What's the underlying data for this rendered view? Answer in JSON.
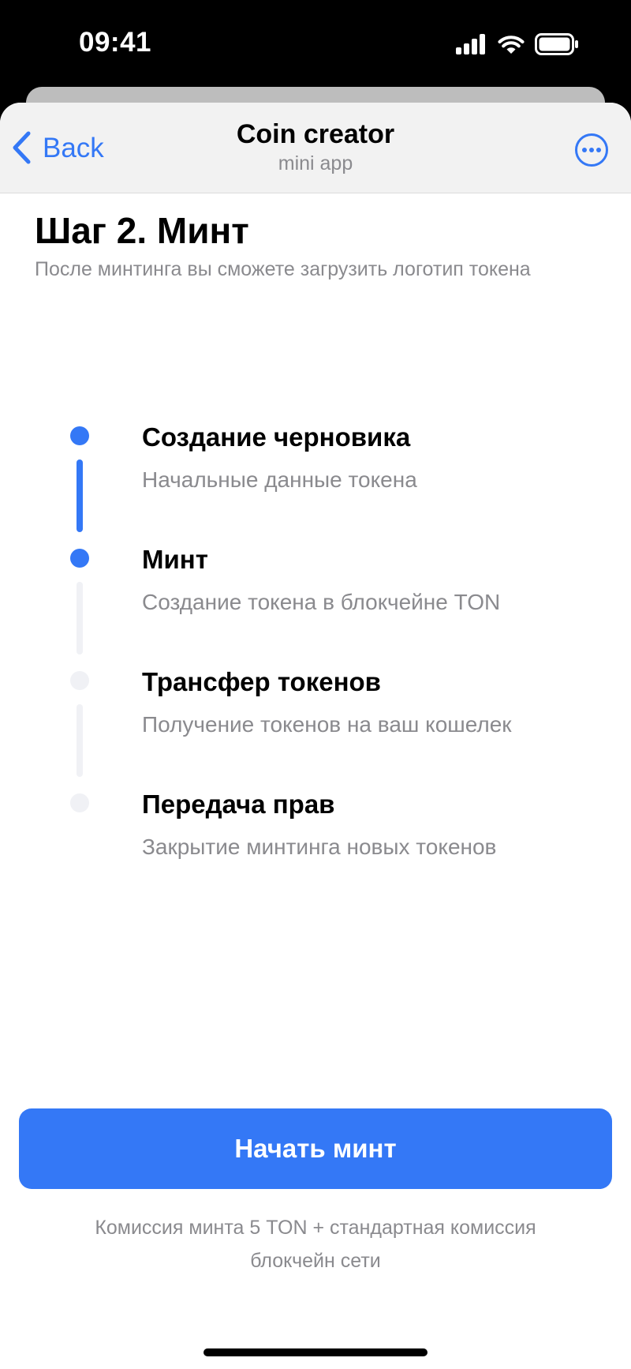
{
  "status_bar": {
    "time": "09:41",
    "icons": [
      "cellular-signal-icon",
      "wifi-icon",
      "battery-icon"
    ]
  },
  "header": {
    "back_label": "Back",
    "title": "Coin creator",
    "subtitle": "mini app",
    "more_icon": "more-ellipsis-icon"
  },
  "page": {
    "title": "Шаг 2. Минт",
    "subtitle": "После минтинга вы сможете загрузить логотип токена"
  },
  "steps": [
    {
      "title": "Создание черновика",
      "description": "Начальные данные токена",
      "active": true
    },
    {
      "title": "Минт",
      "description": "Создание токена в блокчейне TON",
      "active": true
    },
    {
      "title": "Трансфер токенов",
      "description": "Получение токенов на ваш кошелек",
      "active": false
    },
    {
      "title": "Передача прав",
      "description": "Закрытие минтинга новых токенов",
      "active": false
    }
  ],
  "actions": {
    "start_mint_label": "Начать минт",
    "fee_line1": "Комиссия минта 5 TON + стандартная комиссия",
    "fee_line2": "блокчейн сети"
  },
  "colors": {
    "accent": "#3478f6",
    "inactive_step": "#f0f1f5",
    "secondary_text": "#8a8a8e",
    "header_bg": "#f2f2f2"
  }
}
